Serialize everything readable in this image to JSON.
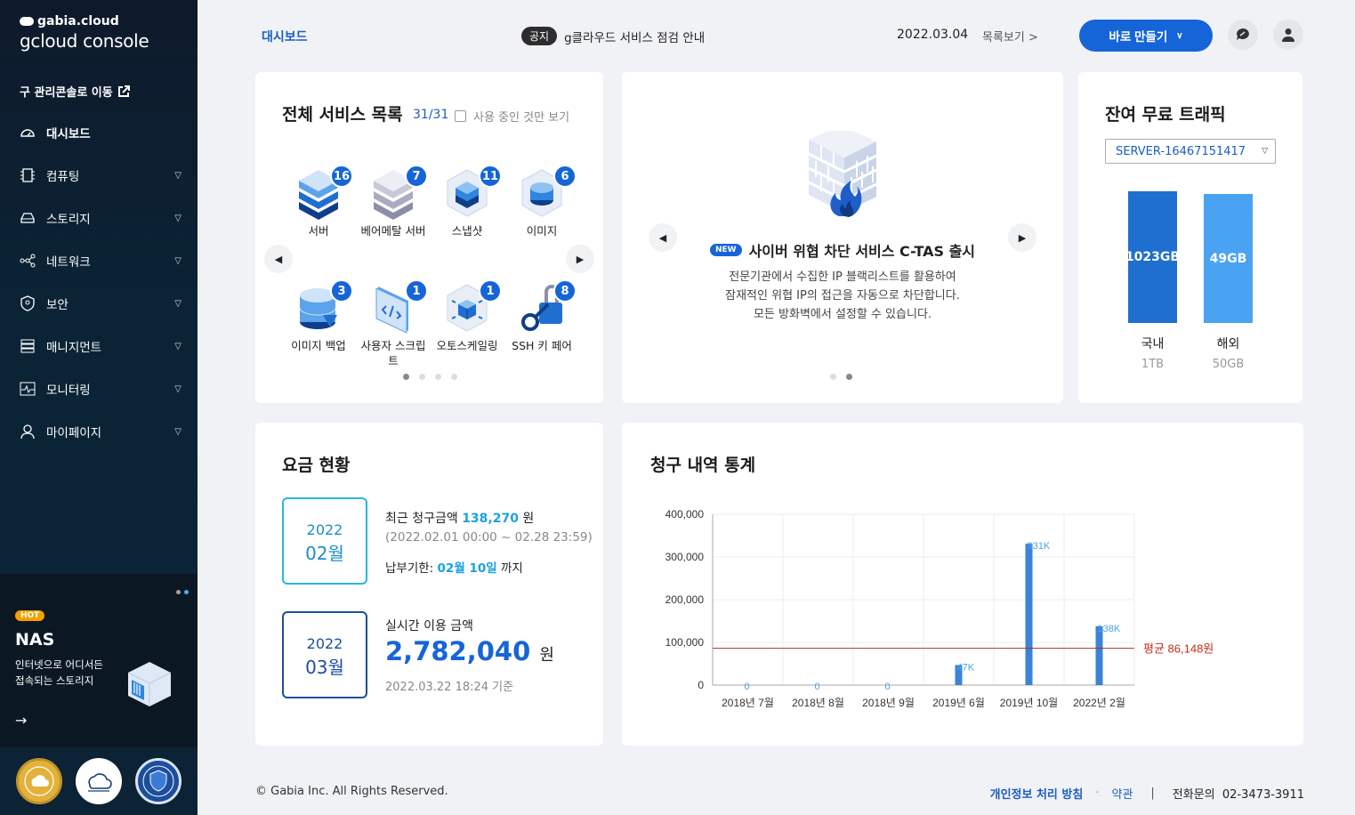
{
  "brand": {
    "top": "gabia.cloud",
    "main": "gcloud console"
  },
  "sidebar": {
    "legacy_link": "구 관리콘솔로 이동",
    "items": [
      {
        "label": "대시보드",
        "icon": "dashboard-icon"
      },
      {
        "label": "컴퓨팅",
        "icon": "chip-icon"
      },
      {
        "label": "스토리지",
        "icon": "drive-icon"
      },
      {
        "label": "네트워크",
        "icon": "network-icon"
      },
      {
        "label": "보안",
        "icon": "shield-icon"
      },
      {
        "label": "매니지먼트",
        "icon": "list-icon"
      },
      {
        "label": "모니터링",
        "icon": "pulse-icon"
      },
      {
        "label": "마이페이지",
        "icon": "user-icon"
      }
    ],
    "promo": {
      "tag": "HOT",
      "title": "NAS",
      "desc1": "인터넷으로 어디서든",
      "desc2": "접속되는 스토리지",
      "arrow": "→"
    }
  },
  "header": {
    "page_title": "대시보드",
    "notice_tag": "공지",
    "notice_text": "g클라우드 서비스 점검 안내",
    "notice_date": "2022.03.04",
    "more_label": "목록보기",
    "make_label": "바로 만들기"
  },
  "services": {
    "title": "전체 서비스 목록",
    "count": "31/31",
    "filter_label": "사용 중인 것만 보기",
    "items": [
      {
        "label": "서버",
        "count": "16"
      },
      {
        "label": "베어메탈 서버",
        "count": "7"
      },
      {
        "label": "스냅샷",
        "count": "11"
      },
      {
        "label": "이미지",
        "count": "6"
      },
      {
        "label": "이미지 백업",
        "count": "3"
      },
      {
        "label": "사용자 스크립트",
        "count": "1"
      },
      {
        "label": "오토스케일링",
        "count": "1"
      },
      {
        "label": "SSH 키 페어",
        "count": "8"
      }
    ]
  },
  "news": {
    "tag": "NEW",
    "title": "사이버 위협 차단 서비스 C-TAS 출시",
    "line1": "전문기관에서 수집한 IP 블랙리스트를 활용하여",
    "line2": "잠재적인 위협 IP의 접근을 자동으로 차단합니다.",
    "line3": "모든 방화벽에서 설정할 수 있습니다."
  },
  "traffic": {
    "title": "잔여 무료 트래픽",
    "server": "SERVER-16467151417",
    "domestic_value": "1023GB",
    "domestic_label": "국내",
    "domestic_total": "1TB",
    "domestic_fraction": 0.999,
    "overseas_value": "49GB",
    "overseas_label": "해외",
    "overseas_total": "50GB",
    "overseas_fraction": 0.98
  },
  "fee": {
    "title": "요금 현황",
    "recent_year": "2022",
    "recent_month": "02월",
    "recent_label": "최근 청구금액",
    "recent_amount": "138,270",
    "won": "원",
    "recent_period": "(2022.02.01 00:00 ~ 02.28 23:59)",
    "due_label": "납부기한:",
    "due_date": "02월 10일",
    "due_suffix": "까지",
    "current_year": "2022",
    "current_month": "03월",
    "current_label": "실시간 이용 금액",
    "current_amount": "2,782,040",
    "current_asof": "2022.03.22 18:24 기준"
  },
  "billing": {
    "title": "청구 내역 통계"
  },
  "chart_data": {
    "type": "bar",
    "title": "청구 내역 통계",
    "categories": [
      "2018년 7월",
      "2018년 8월",
      "2018년 9월",
      "2019년 6월",
      "2019년 10월",
      "2022년 2월"
    ],
    "values": [
      0,
      0,
      0,
      47000,
      331000,
      138000
    ],
    "value_labels": [
      "0",
      "0",
      "0",
      "47K",
      "331K",
      "138K"
    ],
    "yticks": [
      "0",
      "100,000",
      "200,000",
      "300,000",
      "400,000"
    ],
    "ylim": [
      0,
      400000
    ],
    "average": 86148,
    "average_label": "평균 86,148원",
    "colors": {
      "bar": "#3b82d9",
      "average": "#b03020"
    }
  },
  "footer": {
    "copyright": "© Gabia Inc. All Rights Reserved.",
    "privacy": "개인정보 처리 방침",
    "terms": "약관",
    "phone_label": "전화문의",
    "phone": "02-3473-3911"
  }
}
